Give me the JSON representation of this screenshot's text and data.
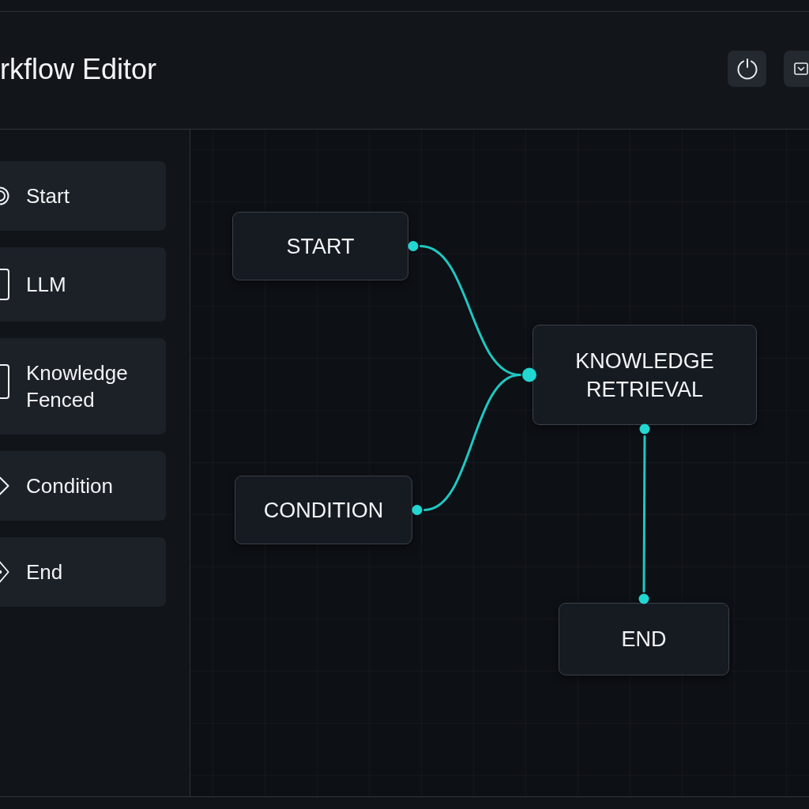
{
  "window": {
    "title": "rkflow Editor"
  },
  "toolbar": [
    {
      "kind": "power"
    },
    {
      "kind": "dropdown"
    }
  ],
  "sidebar": {
    "items": [
      {
        "label": "Start",
        "kind": "start"
      },
      {
        "label": "LLM",
        "kind": "llm"
      },
      {
        "label": "Knowledge Fenced",
        "kind": "knowledge"
      },
      {
        "label": "Condition",
        "kind": "condition"
      },
      {
        "label": "End",
        "kind": "end"
      }
    ]
  },
  "canvas": {
    "nodes": [
      {
        "label": "START"
      },
      {
        "label": "CONDITION"
      },
      {
        "label": "KNOWLEDGE RETRIEVAL"
      },
      {
        "label": "END"
      }
    ]
  }
}
